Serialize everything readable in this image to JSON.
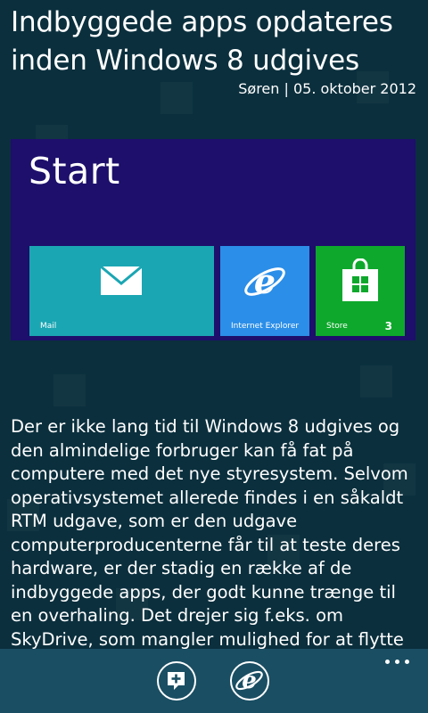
{
  "article": {
    "title": "Indbyggede apps opdateres inden Windows 8 udgives",
    "byline": "Søren | 05. oktober 2012",
    "body": "Der er ikke lang tid til Windows 8 udgives og den almindelige forbruger kan få fat på computere med det nye styresystem. Selvom operativsystemet allerede findes i en såkaldt RTM udgave, som er den udgave computerproducenterne får til at teste deres hardware, er der stadig en række af de indbyggede apps, der godt kunne trænge til en overhaling. Det drejer sig f.eks. om SkyDrive, som mangler mulighed for at flytte rundt på filer. Mail understøtter ikke muligheden for IMAP og alle"
  },
  "screenshot": {
    "start_label": "Start",
    "background_color": "#1d0f6b",
    "tiles": [
      {
        "label": "Mail",
        "icon": "mail-icon",
        "color": "#1ba6b3"
      },
      {
        "label": "Internet Explorer",
        "icon": "internet-explorer-icon",
        "color": "#2b8ee8"
      },
      {
        "label": "Store",
        "icon": "store-icon",
        "color": "#0ea82c",
        "badge": "3"
      }
    ]
  },
  "appbar": {
    "buttons": [
      {
        "icon": "add-comment-icon"
      },
      {
        "icon": "internet-explorer-icon"
      }
    ],
    "more_icon": "ellipsis-icon"
  },
  "colors": {
    "page_background": "#0b2f3d",
    "appbar_background": "#1a4e63",
    "text": "#ffffff"
  }
}
